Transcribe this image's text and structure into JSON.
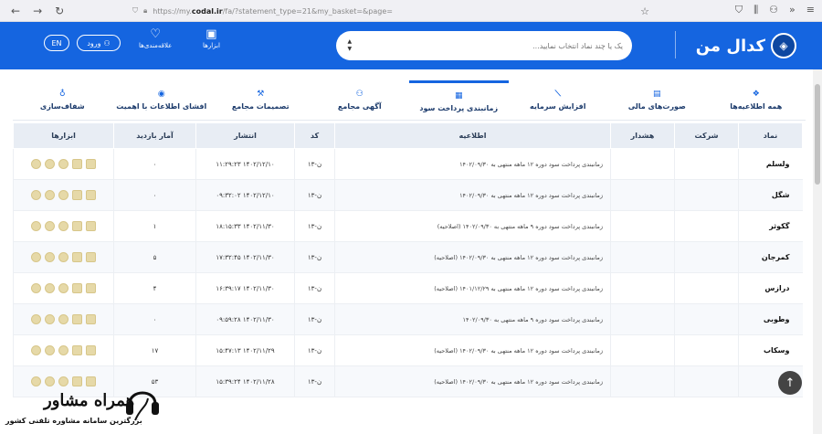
{
  "browser": {
    "url_prefix": "https://my.",
    "url_domain": "codal.ir",
    "url_rest": "/fa/?statement_type=21&my_basket=&page="
  },
  "header": {
    "logo_text": "کدال من",
    "search_placeholder": "یک یا چند نماد انتخاب نمایید...",
    "tools_label": "ابزارها",
    "favorites_label": "علاقه‌مندی‌ها",
    "login_label": "ورود",
    "lang_label": "EN"
  },
  "tabs": [
    {
      "label": "همه اطلاعیه‌ها",
      "icon": "layers-icon"
    },
    {
      "label": "صورت‌های مالی",
      "icon": "document-icon"
    },
    {
      "label": "افزایش سرمایه",
      "icon": "chart-icon"
    },
    {
      "label": "زمانبندی پرداخت سود",
      "icon": "calendar-icon",
      "active": true
    },
    {
      "label": "آگهی مجامع",
      "icon": "people-icon"
    },
    {
      "label": "تصمیمات مجامع",
      "icon": "gavel-icon"
    },
    {
      "label": "افشای اطلاعات با اهمیت",
      "icon": "eye-icon"
    },
    {
      "label": "شفاف‌سازی",
      "icon": "bulb-icon"
    }
  ],
  "table": {
    "headers": [
      "نماد",
      "شرکت",
      "هشدار",
      "اطلاعیه",
      "کد",
      "انتشار",
      "آمار بازدید",
      "ابزارها"
    ],
    "rows": [
      {
        "symbol": "ولسلم",
        "title": "زمانبندی پرداخت سود دوره ۱۲ ماهه منتهی به ۱۴۰۲/۰۹/۳۰",
        "code": "ن-۱۳",
        "date": "۱۴۰۲/۱۲/۱۰ ۱۱:۲۹:۲۳",
        "views": "۰"
      },
      {
        "symbol": "شگل",
        "title": "زمانبندی پرداخت سود دوره ۱۲ ماهه منتهی به ۱۴۰۲/۰۹/۳۰",
        "code": "ن-۱۳",
        "date": "۱۴۰۲/۱۲/۱۰ ۰۹:۳۲:۰۲",
        "views": "۰"
      },
      {
        "symbol": "گکوثر",
        "title": "زمانبندی پرداخت سود دوره ۹ ماهه منتهی به ۱۴۰۲/۰۹/۳۰ (اصلاحیه)",
        "code": "ن-۱۳",
        "date": "۱۴۰۲/۱۱/۳۰ ۱۸:۱۵:۳۳",
        "views": "۱"
      },
      {
        "symbol": "کمرجان",
        "title": "زمانبندی پرداخت سود دوره ۱۲ ماهه منتهی به ۱۴۰۲/۰۹/۳۰ (اصلاحیه)",
        "code": "ن-۱۳",
        "date": "۱۴۰۲/۱۱/۳۰ ۱۷:۳۲:۴۵",
        "views": "۵"
      },
      {
        "symbol": "درازس",
        "title": "زمانبندی پرداخت سود دوره ۱۲ ماهه منتهی به ۱۴۰۱/۱۲/۲۹ (اصلاحیه)",
        "code": "ن-۱۳",
        "date": "۱۴۰۲/۱۱/۳۰ ۱۶:۳۹:۱۷",
        "views": "۴"
      },
      {
        "symbol": "وطوبی",
        "title": "زمانبندی پرداخت سود دوره ۹ ماهه منتهی به ۱۴۰۲/۰۹/۳۰",
        "code": "ن-۱۳",
        "date": "۱۴۰۲/۱۱/۳۰ ۰۹:۵۹:۲۸",
        "views": "۰"
      },
      {
        "symbol": "وسکاب",
        "title": "زمانبندی پرداخت سود دوره ۱۲ ماهه منتهی به ۱۴۰۲/۰۹/۳۰ (اصلاحیه)",
        "code": "ن-۱۳",
        "date": "۱۴۰۲/۱۱/۲۹ ۱۵:۴۷:۱۳",
        "views": "۱۷"
      },
      {
        "symbol": "",
        "title": "زمانبندی پرداخت سود دوره ۱۲ ماهه منتهی به ۱۴۰۲/۰۹/۳۰ (اصلاحیه)",
        "code": "ن-۱۳",
        "date": "۱۴۰۲/۱۱/۲۸ ۱۵:۳۹:۲۴",
        "views": "۵۳"
      }
    ]
  },
  "watermark": {
    "title": "همراه مشاور",
    "subtitle": "بزرگترین سامانه مشاوره تلفنی کشور"
  }
}
